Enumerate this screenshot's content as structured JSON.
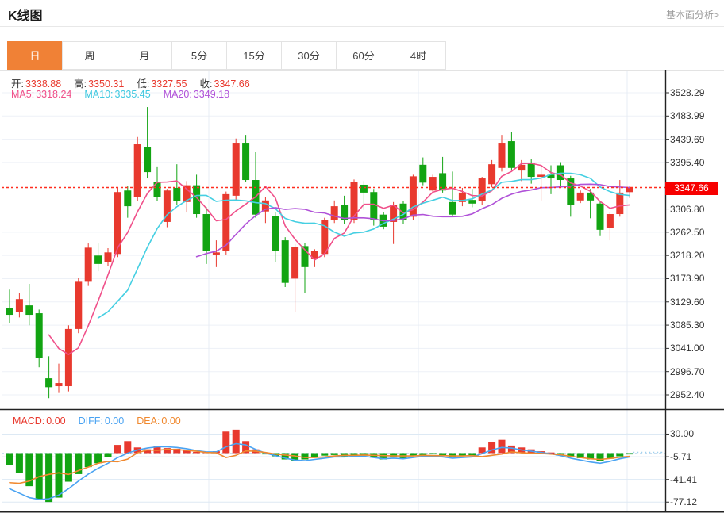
{
  "header": {
    "title": "K线图",
    "link": "基本面分析>"
  },
  "tabs": [
    {
      "label": "日",
      "active": true
    },
    {
      "label": "周",
      "active": false
    },
    {
      "label": "月",
      "active": false
    },
    {
      "label": "5分",
      "active": false
    },
    {
      "label": "15分",
      "active": false
    },
    {
      "label": "30分",
      "active": false
    },
    {
      "label": "60分",
      "active": false
    },
    {
      "label": "4时",
      "active": false
    }
  ],
  "ohlc_legend": {
    "items": [
      {
        "label": "开:",
        "value": "3338.88"
      },
      {
        "label": "高:",
        "value": "3350.31"
      },
      {
        "label": "低:",
        "value": "3327.55"
      },
      {
        "label": "收:",
        "value": "3347.66"
      }
    ]
  },
  "ma_legend": [
    {
      "label": "MA5:",
      "value": "3318.24",
      "color": "#f0508a"
    },
    {
      "label": "MA10:",
      "value": "3335.45",
      "color": "#3fc8e0"
    },
    {
      "label": "MA20:",
      "value": "3349.18",
      "color": "#b052d8"
    }
  ],
  "macd_legend": [
    {
      "label": "MACD:",
      "value": "0.00",
      "color": "#e8392e"
    },
    {
      "label": "DIFF:",
      "value": "0.00",
      "color": "#4aa3f2"
    },
    {
      "label": "DEA:",
      "value": "0.00",
      "color": "#f0892f"
    }
  ],
  "price_badge": "3347.66",
  "colors": {
    "up": "#e8392e",
    "down": "#12a412",
    "ma5": "#f0508a",
    "ma10": "#45cfe2",
    "ma20": "#b052d8",
    "diff": "#4aa3f2",
    "dea": "#f0892f",
    "dashed_price": "#ff2d1f",
    "badge_bg": "#f70000",
    "tab_active_bg": "#f08136",
    "link": "#999999",
    "grid": "#edf1f7",
    "grid_macd": "#dde9f4",
    "grid_vert": "#e7ecf4",
    "border_dark": "#222222",
    "border_light": "#e3e3e3",
    "label_text": "#333333",
    "value_red": "#e8392e",
    "zero_dash": "#c9def0",
    "diff_dotted": "#9fd2f0"
  },
  "chart_data": {
    "type": "candlestick+macd",
    "title": "K线图",
    "y_axis_labels": [
      "3528.29",
      "3483.99",
      "3439.69",
      "3395.40",
      "3306.80",
      "3262.50",
      "3218.20",
      "3173.90",
      "3129.60",
      "3085.30",
      "3041.00",
      "2996.70",
      "2952.40"
    ],
    "macd_axis_labels": [
      "30.00",
      "-5.71",
      "-41.41",
      "-77.12"
    ],
    "current_price": 3347.66,
    "last_candle": {
      "open": 3338.88,
      "high": 3350.31,
      "low": 3327.55,
      "close": 3347.66
    },
    "ma_periods": [
      5,
      10,
      20
    ],
    "grid": true,
    "legend_position": "top-left",
    "candles": [
      [
        3118,
        3153,
        3090,
        3105
      ],
      [
        3111,
        3146,
        3100,
        3135
      ],
      [
        3123,
        3164,
        3085,
        3105
      ],
      [
        3108,
        3115,
        3005,
        3022
      ],
      [
        2984,
        3026,
        2946,
        2967
      ],
      [
        2969,
        3012,
        2956,
        2975
      ],
      [
        2969,
        3085,
        2959,
        3078
      ],
      [
        3078,
        3176,
        3070,
        3168
      ],
      [
        3168,
        3241,
        3160,
        3233
      ],
      [
        3218,
        3241,
        3188,
        3202
      ],
      [
        3206,
        3232,
        3198,
        3224
      ],
      [
        3221,
        3347,
        3215,
        3339
      ],
      [
        3342,
        3350,
        3290,
        3312
      ],
      [
        3330,
        3444,
        3322,
        3430
      ],
      [
        3425,
        3501,
        3365,
        3377
      ],
      [
        3358,
        3388,
        3322,
        3330
      ],
      [
        3282,
        3345,
        3272,
        3342
      ],
      [
        3347,
        3392,
        3315,
        3322
      ],
      [
        3320,
        3360,
        3300,
        3352
      ],
      [
        3352,
        3372,
        3290,
        3297
      ],
      [
        3297,
        3310,
        3202,
        3226
      ],
      [
        3220,
        3247,
        3196,
        3224
      ],
      [
        3226,
        3340,
        3220,
        3335
      ],
      [
        3332,
        3441,
        3325,
        3433
      ],
      [
        3433,
        3448,
        3358,
        3362
      ],
      [
        3362,
        3415,
        3290,
        3296
      ],
      [
        3302,
        3330,
        3280,
        3323
      ],
      [
        3294,
        3300,
        3205,
        3226
      ],
      [
        3247,
        3253,
        3158,
        3166
      ],
      [
        3174,
        3240,
        3111,
        3234
      ],
      [
        3236,
        3242,
        3146,
        3196
      ],
      [
        3211,
        3230,
        3196,
        3226
      ],
      [
        3221,
        3290,
        3215,
        3285
      ],
      [
        3285,
        3323,
        3280,
        3312
      ],
      [
        3315,
        3332,
        3278,
        3285
      ],
      [
        3286,
        3363,
        3280,
        3358
      ],
      [
        3353,
        3360,
        3305,
        3338
      ],
      [
        3339,
        3345,
        3275,
        3286
      ],
      [
        3296,
        3300,
        3268,
        3273
      ],
      [
        3282,
        3320,
        3240,
        3315
      ],
      [
        3317,
        3322,
        3278,
        3285
      ],
      [
        3292,
        3372,
        3286,
        3369
      ],
      [
        3391,
        3405,
        3352,
        3357
      ],
      [
        3342,
        3372,
        3336,
        3368
      ],
      [
        3375,
        3406,
        3338,
        3342
      ],
      [
        3320,
        3378,
        3292,
        3296
      ],
      [
        3320,
        3347,
        3312,
        3338
      ],
      [
        3324,
        3345,
        3310,
        3317
      ],
      [
        3322,
        3368,
        3315,
        3365
      ],
      [
        3354,
        3400,
        3348,
        3392
      ],
      [
        3385,
        3448,
        3378,
        3433
      ],
      [
        3436,
        3453,
        3380,
        3385
      ],
      [
        3380,
        3400,
        3360,
        3391
      ],
      [
        3395,
        3402,
        3355,
        3368
      ],
      [
        3368,
        3390,
        3323,
        3372
      ],
      [
        3372,
        3390,
        3335,
        3365
      ],
      [
        3390,
        3396,
        3350,
        3362
      ],
      [
        3365,
        3370,
        3292,
        3315
      ],
      [
        3323,
        3342,
        3318,
        3338
      ],
      [
        3338,
        3345,
        3289,
        3323
      ],
      [
        3317,
        3322,
        3255,
        3267
      ],
      [
        3271,
        3300,
        3247,
        3297
      ],
      [
        3297,
        3362,
        3292,
        3338
      ],
      [
        3338.88,
        3350.31,
        3327.55,
        3347.66
      ]
    ],
    "macd": {
      "hist": [
        -19,
        -31,
        -52,
        -72,
        -77,
        -70,
        -45,
        -33,
        -22,
        -16,
        -6,
        13,
        19,
        9,
        6,
        11,
        8,
        7,
        5,
        2,
        2,
        3,
        34,
        37,
        19,
        6,
        -2,
        -5,
        -10,
        -13,
        -10,
        -6,
        -4,
        -3,
        -5,
        -3,
        -4,
        -7,
        -10,
        -7,
        -9,
        -5,
        -3,
        -2,
        -4,
        -7,
        -5,
        -4,
        9,
        17,
        21,
        12,
        9,
        6,
        3,
        1,
        -3,
        -6,
        -8,
        -10,
        -12,
        -9,
        -5,
        -2
      ],
      "diff": [
        -56,
        -63,
        -70,
        -73,
        -72,
        -66,
        -56,
        -44,
        -33,
        -24,
        -16,
        -7,
        0,
        5,
        8,
        10,
        10,
        9,
        7,
        4,
        2,
        2,
        10,
        15,
        13,
        6,
        0,
        -4,
        -8,
        -11,
        -12,
        -10,
        -8,
        -6,
        -6,
        -5,
        -5,
        -7,
        -9,
        -8,
        -9,
        -7,
        -5,
        -5,
        -6,
        -8,
        -7,
        -6,
        -1,
        5,
        9,
        8,
        5,
        3,
        1,
        -1,
        -4,
        -8,
        -11,
        -14,
        -16,
        -13,
        -9,
        -6
      ]
    }
  }
}
